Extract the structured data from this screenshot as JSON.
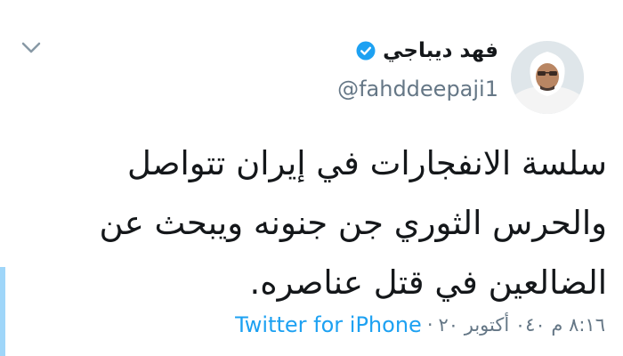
{
  "tweet": {
    "author": {
      "display_name": "فهد ديباجي",
      "handle": "@fahddeepaji1"
    },
    "text_lines": [
      "سلسة الانفجارات في إيران تتواصل",
      "والحرس الثوري جن جنونه ويبحث عن",
      "الضالعين في قتل عناصره."
    ],
    "meta": {
      "time": "٨:١٦ م ٠٤٠ أكتوبر ٢٠",
      "separator": "·",
      "source": "Twitter for iPhone"
    }
  },
  "colors": {
    "accent": "#1da1f2",
    "muted": "#657786",
    "text": "#14171a"
  },
  "icons": {
    "verified": "verified-badge-icon",
    "menu": "chevron-down-icon"
  }
}
